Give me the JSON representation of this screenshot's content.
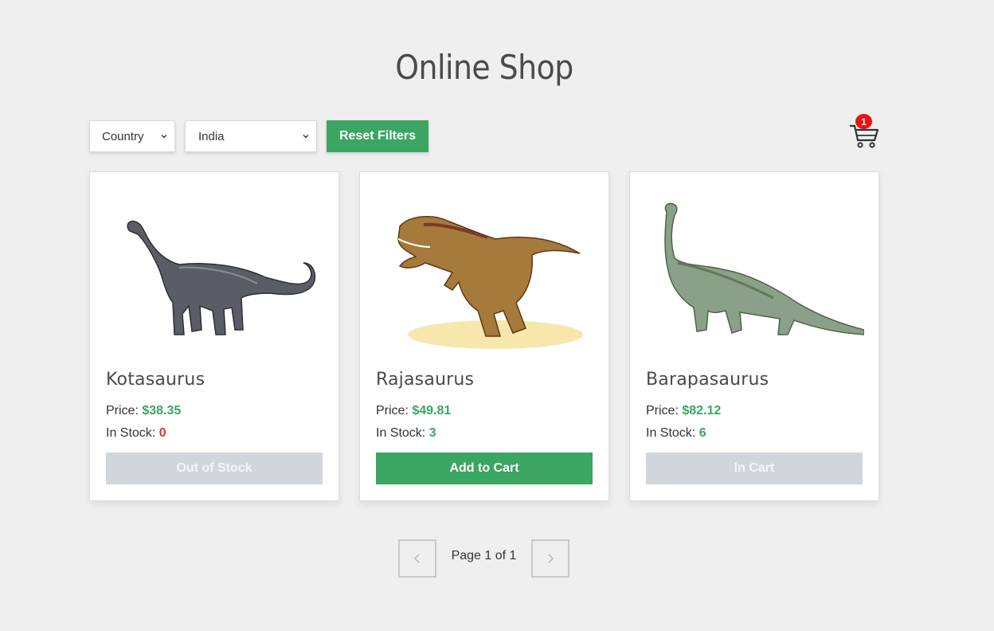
{
  "page": {
    "title": "Online Shop"
  },
  "filters": {
    "country_select": "Country",
    "region_select": "India",
    "reset_label": "Reset Filters"
  },
  "cart": {
    "count": "1",
    "icon": "shopping-cart-icon"
  },
  "products": [
    {
      "name": "Kotasaurus",
      "price_label": "Price: ",
      "price": "$38.35",
      "stock_label": "In Stock: ",
      "stock": "0",
      "action": "Out of Stock",
      "action_state": "disabled"
    },
    {
      "name": "Rajasaurus",
      "price_label": "Price: ",
      "price": "$49.81",
      "stock_label": "In Stock: ",
      "stock": "3",
      "action": "Add to Cart",
      "action_state": "enabled"
    },
    {
      "name": "Barapasaurus",
      "price_label": "Price: ",
      "price": "$82.12",
      "stock_label": "In Stock: ",
      "stock": "6",
      "action": "In Cart",
      "action_state": "disabled"
    }
  ],
  "pagination": {
    "label": "Page 1 of 1",
    "prev_icon": "chevron-left-icon",
    "next_icon": "chevron-right-icon"
  },
  "colors": {
    "accent": "#3ba562",
    "out_of_stock": "#e03030",
    "badge": "#ee1111",
    "disabled_button": "#d1d5dc"
  }
}
